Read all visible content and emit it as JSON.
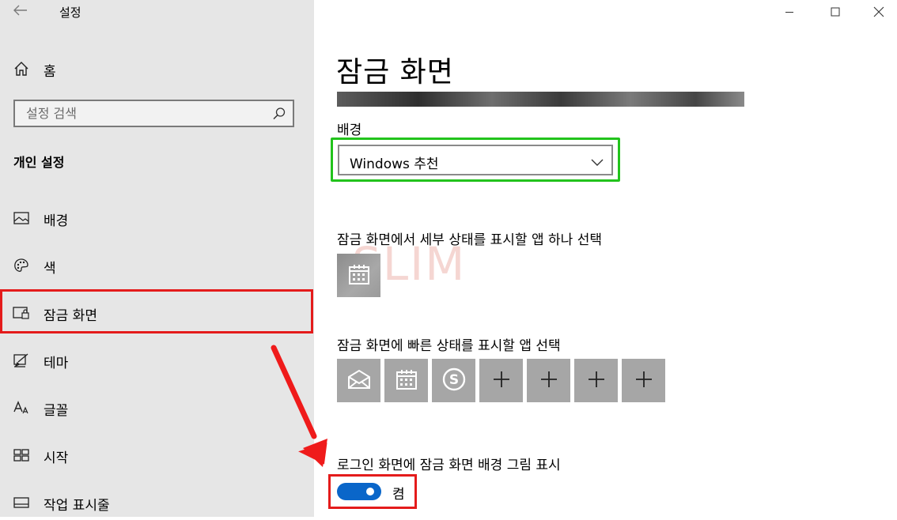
{
  "window": {
    "title": "설정",
    "controls": [
      "minimize",
      "maximize",
      "close"
    ]
  },
  "sidebar": {
    "home_label": "홈",
    "search_placeholder": "설정 검색",
    "section_header": "개인 설정",
    "items": [
      {
        "label": "배경",
        "icon": "picture-icon"
      },
      {
        "label": "색",
        "icon": "palette-icon"
      },
      {
        "label": "잠금 화면",
        "icon": "lock-screen-icon",
        "selected": true
      },
      {
        "label": "테마",
        "icon": "theme-brush-icon"
      },
      {
        "label": "글꼴",
        "icon": "font-icon"
      },
      {
        "label": "시작",
        "icon": "start-icon"
      },
      {
        "label": "작업 표시줄",
        "icon": "taskbar-icon"
      }
    ]
  },
  "main": {
    "title": "잠금 화면",
    "background_label": "배경",
    "background_value": "Windows 추천",
    "detailed_status_label": "잠금 화면에서 세부 상태를 표시할 앱 하나 선택",
    "quick_status_label": "잠금 화면에 빠른 상태를 표시할 앱 선택",
    "quick_status_apps": [
      "mail-icon",
      "calendar-icon",
      "skype-icon",
      "plus-icon",
      "plus-icon",
      "plus-icon",
      "plus-icon"
    ],
    "watermark": "SLIM",
    "signin_bg_label": "로그인 화면에 잠금 화면 배경 그림 표시",
    "signin_bg_toggle_state": "켬",
    "signin_bg_toggle_on": true
  },
  "annotation_colors": {
    "red_highlight": "#e41b1b",
    "green_highlight": "#22c31c",
    "accent": "#0a66c9"
  }
}
